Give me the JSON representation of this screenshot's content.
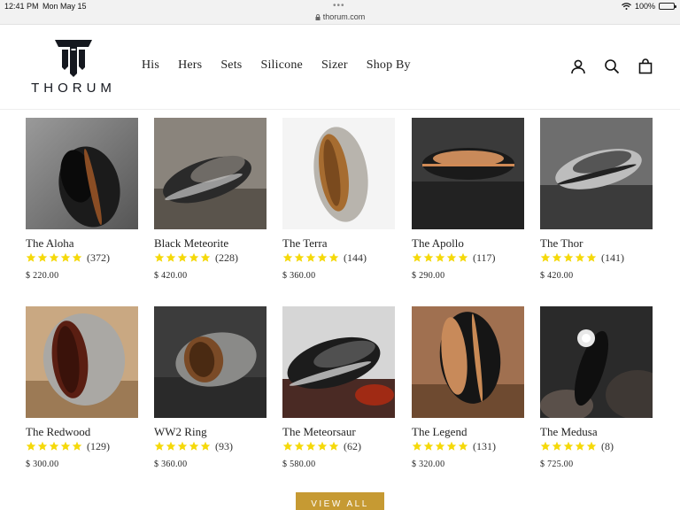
{
  "status_bar": {
    "time": "12:41 PM",
    "date": "Mon May 15",
    "url": "thorum.com",
    "battery": "100%"
  },
  "brand": {
    "name": "THORUM"
  },
  "nav": [
    {
      "label": "His"
    },
    {
      "label": "Hers"
    },
    {
      "label": "Sets"
    },
    {
      "label": "Silicone"
    },
    {
      "label": "Sizer"
    },
    {
      "label": "Shop By"
    }
  ],
  "header_icons": [
    "account-icon",
    "search-icon",
    "cart-icon"
  ],
  "colors": {
    "star": "#f5d90a",
    "button": "#c69a33",
    "brand": "#15181f"
  },
  "products": [
    {
      "name": "The Aloha",
      "reviews": "(372)",
      "price": "$ 220.00",
      "rating": 5
    },
    {
      "name": "Black Meteorite",
      "reviews": "(228)",
      "price": "$ 420.00",
      "rating": 5
    },
    {
      "name": "The Terra",
      "reviews": "(144)",
      "price": "$ 360.00",
      "rating": 5
    },
    {
      "name": "The Apollo",
      "reviews": "(117)",
      "price": "$ 290.00",
      "rating": 5
    },
    {
      "name": "The Thor",
      "reviews": "(141)",
      "price": "$ 420.00",
      "rating": 5
    },
    {
      "name": "The Redwood",
      "reviews": "(129)",
      "price": "$ 300.00",
      "rating": 5
    },
    {
      "name": "WW2 Ring",
      "reviews": "(93)",
      "price": "$ 360.00",
      "rating": 5
    },
    {
      "name": "The Meteorsaur",
      "reviews": "(62)",
      "price": "$ 580.00",
      "rating": 5
    },
    {
      "name": "The Legend",
      "reviews": "(131)",
      "price": "$ 320.00",
      "rating": 5
    },
    {
      "name": "The Medusa",
      "reviews": "(8)",
      "price": "$ 725.00",
      "rating": 5
    }
  ],
  "view_all": "VIEW ALL"
}
